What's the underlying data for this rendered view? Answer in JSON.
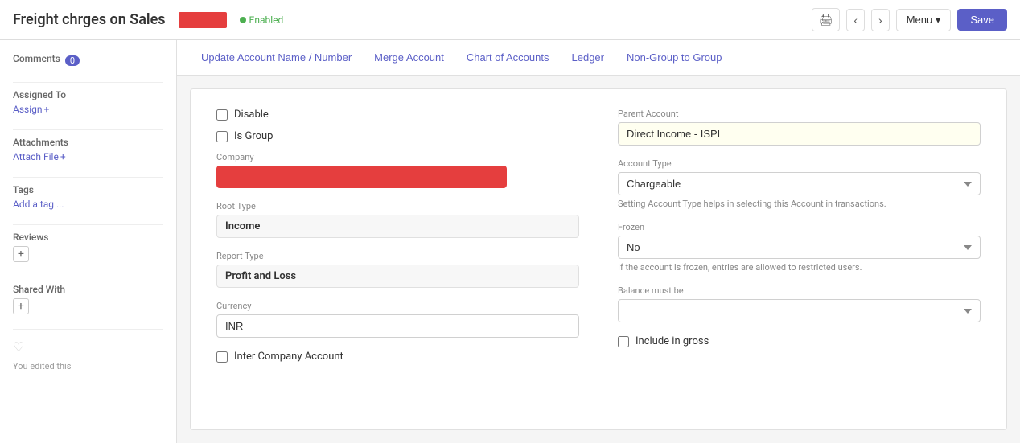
{
  "header": {
    "title": "Freight chrges on Sales",
    "status": "Enabled",
    "menu_label": "Menu ▾",
    "save_label": "Save"
  },
  "action_bar": {
    "buttons": [
      {
        "label": "Update Account Name / Number",
        "id": "update-account-name"
      },
      {
        "label": "Merge Account",
        "id": "merge-account"
      },
      {
        "label": "Chart of Accounts",
        "id": "chart-of-accounts"
      },
      {
        "label": "Ledger",
        "id": "ledger"
      },
      {
        "label": "Non-Group to Group",
        "id": "non-group-to-group"
      }
    ]
  },
  "sidebar": {
    "comments_label": "Comments",
    "comments_count": "0",
    "assigned_to_label": "Assigned To",
    "assign_label": "Assign",
    "attachments_label": "Attachments",
    "attach_file_label": "Attach File",
    "tags_label": "Tags",
    "add_tag_label": "Add a tag ...",
    "reviews_label": "Reviews",
    "shared_with_label": "Shared With",
    "footer_text": "You edited this"
  },
  "form": {
    "disable_label": "Disable",
    "is_group_label": "Is Group",
    "company_label": "Company",
    "root_type_label": "Root Type",
    "root_type_value": "Income",
    "report_type_label": "Report Type",
    "report_type_value": "Profit and Loss",
    "currency_label": "Currency",
    "currency_value": "INR",
    "inter_company_label": "Inter Company Account",
    "parent_account_label": "Parent Account",
    "parent_account_value": "Direct Income - ISPL",
    "account_type_label": "Account Type",
    "account_type_value": "Chargeable",
    "account_type_help": "Setting Account Type helps in selecting this Account in transactions.",
    "frozen_label": "Frozen",
    "frozen_value": "No",
    "frozen_help": "If the account is frozen, entries are allowed to restricted users.",
    "balance_must_be_label": "Balance must be",
    "balance_must_be_value": "",
    "include_gross_label": "Include in gross"
  }
}
